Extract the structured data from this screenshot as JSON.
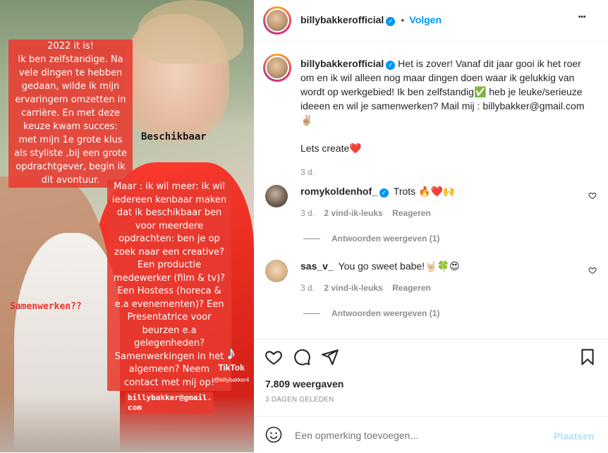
{
  "story": {
    "box1": [
      "2022 it is!",
      "Ik ben zelfstandige. Na",
      "vele dingen te hebben",
      "gedaan, wilde ik mijn",
      "ervaringem omzetten in",
      "carrière.  En met deze",
      "keuze kwam succes:",
      "met mijn 1e grote klus",
      "als styliste ,bij een grote",
      "opdrachtgever, begin ik",
      "dit avontuur."
    ],
    "beschikbaar": "Beschikbaar",
    "box2": [
      "Maar : ik wil meer: ik wil",
      "iedereen kenbaar maken",
      "dat ik beschikbaar ben",
      "voor meerdere",
      "opdrachten: ben je op",
      "zoek naar een creative?",
      "Een productie",
      "medewerker (film & tv)?",
      "Een Hostess (horeca &",
      "e.a evenementen)? Een",
      "Presentatrice voor",
      "beurzen e.a",
      "gelegenheden?",
      "Samenwerkingen in het",
      "algemeen? Neem",
      "contact met mij op!"
    ],
    "samenwerken": "Samenwerken??",
    "email_lines": [
      "billybakker@gmail.",
      "com"
    ],
    "tiktok_label": "TikTok",
    "tiktok_handle": "@billybakker4"
  },
  "header": {
    "username": "billybakkerofficial",
    "dot": "•",
    "follow": "Volgen",
    "more": "•••"
  },
  "caption": {
    "username": "billybakkerofficial",
    "text_part1": "Het is zover! Vanaf dit jaar gooi ik het roer om en ik wil alleen nog maar dingen doen waar ik gelukkig van wordt op werkgebied! Ik ben zelfstandig",
    "check": "✅",
    "text_part2": " heb je leuke/serieuze ideeen en wil je samenwerken? Mail mij : billybakker@gmail.com",
    "peace": "✌🏼",
    "lets_create": "Lets create",
    "heart": "❤️",
    "time": "3 d."
  },
  "comments": [
    {
      "username": "romykoldenhof_",
      "verified": true,
      "text": "Trots 🔥❤️🙌",
      "time": "3 d.",
      "likes": "2 vind-ik-leuks",
      "reply": "Reageren",
      "view_replies": "Antwoorden weergeven (1)"
    },
    {
      "username": "sas_v_",
      "verified": false,
      "text": "You go sweet babe!🤘🏻🍀😍",
      "time": "3 d.",
      "likes": "2 vind-ik-leuks",
      "reply": "Reageren",
      "view_replies": "Antwoorden weergeven (1)"
    }
  ],
  "stats": {
    "views": "7.809 weergaven",
    "date": "3 DAGEN GELEDEN"
  },
  "composer": {
    "placeholder": "Een opmerking toevoegen...",
    "post": "Plaatsen"
  },
  "colors": {
    "accent": "#0095f6",
    "story_red": "#e83a30",
    "like_red": "#ed4956"
  }
}
